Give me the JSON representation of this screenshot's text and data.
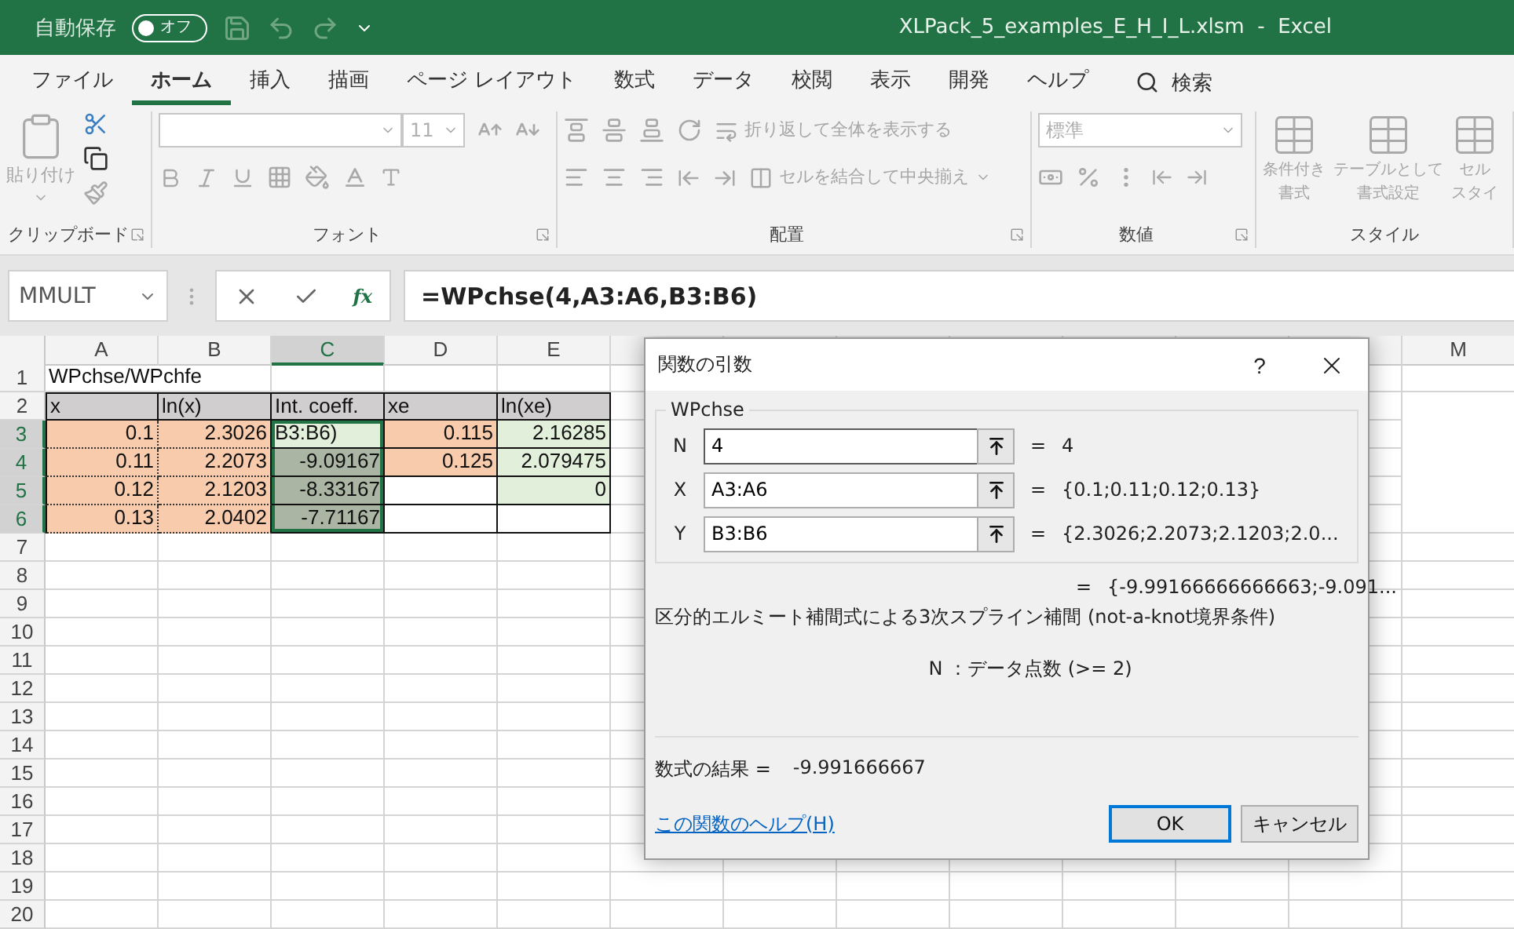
{
  "title_bar": {
    "autosave_label": "自動保存",
    "autosave": {
      "on": false,
      "label": "オフ"
    },
    "title": "XLPack_5_examples_E_H_I_L.xlsm  -  Excel"
  },
  "menu_tabs": [
    {
      "label": "ファイル",
      "selected": false
    },
    {
      "label": "ホーム",
      "selected": true
    },
    {
      "label": "挿入",
      "selected": false
    },
    {
      "label": "描画",
      "selected": false
    },
    {
      "label": "ページ レイアウト",
      "selected": false
    },
    {
      "label": "数式",
      "selected": false
    },
    {
      "label": "データ",
      "selected": false
    },
    {
      "label": "校閲",
      "selected": false
    },
    {
      "label": "表示",
      "selected": false
    },
    {
      "label": "開発",
      "selected": false
    },
    {
      "label": "ヘルプ",
      "selected": false
    }
  ],
  "search_label": "検索",
  "ribbon": {
    "disabled": true,
    "groups": [
      {
        "kind": "clipboard",
        "label": "クリップボード",
        "launcher": true,
        "paste": "貼り付け"
      },
      {
        "kind": "font",
        "label": "フォント",
        "launcher": true,
        "font_size": "11"
      },
      {
        "kind": "alignment",
        "label": "配置",
        "launcher": true,
        "wrap": "折り返して全体を表示する",
        "merge": "セルを結合して中央揃え"
      },
      {
        "kind": "number",
        "label": "数値",
        "launcher": true,
        "format": "標準"
      },
      {
        "kind": "styles",
        "label": "スタイル",
        "launcher": false,
        "buttons": [
          {
            "lines": [
              "条件付き",
              "書式"
            ]
          },
          {
            "lines": [
              "テーブルとして",
              "書式設定"
            ]
          },
          {
            "lines": [
              "セル",
              "スタイ"
            ]
          }
        ]
      }
    ]
  },
  "formula_bar": {
    "name_box": "MMULT",
    "function_button": "fx",
    "formula": "=WPchse(4,A3:A6,B3:B6)"
  },
  "sheet": {
    "columns": [
      {
        "label": "A",
        "selected": false
      },
      {
        "label": "B",
        "selected": false
      },
      {
        "label": "C",
        "selected": true
      },
      {
        "label": "D",
        "selected": false
      },
      {
        "label": "E",
        "selected": false
      },
      {
        "label": "M",
        "selected": false
      }
    ],
    "rows": [
      {
        "header": "1",
        "selected": false,
        "cells": [
          {
            "text": "WPchse/WPchfe",
            "kind": "text"
          }
        ]
      },
      {
        "header": "2",
        "selected": false,
        "cells": [
          {
            "text": "x",
            "kind": "text",
            "bordered": true,
            "color": "#d0cece"
          },
          {
            "text": "ln(x)",
            "kind": "text",
            "bordered": true,
            "color": "#d0cece"
          },
          {
            "text": "Int. coeff.",
            "kind": "text",
            "bordered": true,
            "color": "#d0cece"
          },
          {
            "text": "xe",
            "kind": "text",
            "bordered": true,
            "color": "#d0cece"
          },
          {
            "text": "ln(xe)",
            "kind": "text",
            "bordered": true,
            "color": "#d0cece"
          }
        ]
      },
      {
        "header": "3",
        "selected": true,
        "cells": [
          {
            "text": "0.1",
            "kind": "number",
            "bordered": true,
            "dotted": true,
            "color": "#f8cbad"
          },
          {
            "text": "2.3026",
            "kind": "number",
            "bordered": true,
            "dotted": true,
            "color": "#f8cbad"
          },
          {
            "text": "B3:B6)",
            "kind": "text",
            "bordered": true,
            "color": "#e2efda",
            "selected": true
          },
          {
            "text": "0.115",
            "kind": "number",
            "bordered": true,
            "color": "#f8cbad"
          },
          {
            "text": "2.16285",
            "kind": "number",
            "bordered": true,
            "color": "#e2efda"
          }
        ]
      },
      {
        "header": "4",
        "selected": true,
        "cells": [
          {
            "text": "0.11",
            "kind": "number",
            "bordered": true,
            "dotted": true,
            "color": "#f8cbad"
          },
          {
            "text": "2.2073",
            "kind": "number",
            "bordered": true,
            "dotted": true,
            "color": "#f8cbad"
          },
          {
            "text": "-9.09167",
            "kind": "number",
            "bordered": true,
            "color": "#aab5a4",
            "selected": true
          },
          {
            "text": "0.125",
            "kind": "number",
            "bordered": true,
            "color": "#f8cbad"
          },
          {
            "text": "2.079475",
            "kind": "number",
            "bordered": true,
            "color": "#e2efda"
          }
        ]
      },
      {
        "header": "5",
        "selected": true,
        "cells": [
          {
            "text": "0.12",
            "kind": "number",
            "bordered": true,
            "dotted": true,
            "color": "#f8cbad"
          },
          {
            "text": "2.1203",
            "kind": "number",
            "bordered": true,
            "dotted": true,
            "color": "#f8cbad"
          },
          {
            "text": "-8.33167",
            "kind": "number",
            "bordered": true,
            "color": "#aab5a4",
            "selected": true
          },
          {
            "bordered": true
          },
          {
            "text": "0",
            "kind": "number",
            "bordered": true,
            "color": "#e2efda"
          }
        ]
      },
      {
        "header": "6",
        "selected": true,
        "cells": [
          {
            "text": "0.13",
            "kind": "number",
            "bordered": true,
            "dotted": true,
            "color": "#f8cbad"
          },
          {
            "text": "2.0402",
            "kind": "number",
            "bordered": true,
            "dotted": true,
            "color": "#f8cbad"
          },
          {
            "text": "-7.71167",
            "kind": "number",
            "bordered": true,
            "color": "#aab5a4",
            "selected": true
          },
          {
            "bordered": true
          },
          {
            "bordered": true
          }
        ]
      },
      {
        "header": "7",
        "selected": false
      },
      {
        "header": "8",
        "selected": false
      },
      {
        "header": "9",
        "selected": false
      },
      {
        "header": "10",
        "selected": false
      },
      {
        "header": "11",
        "selected": false
      },
      {
        "header": "12",
        "selected": false
      },
      {
        "header": "13",
        "selected": false
      },
      {
        "header": "14",
        "selected": false
      },
      {
        "header": "15",
        "selected": false
      },
      {
        "header": "16",
        "selected": false
      },
      {
        "header": "17",
        "selected": false
      },
      {
        "header": "18",
        "selected": false
      },
      {
        "header": "19",
        "selected": false
      },
      {
        "header": "20",
        "selected": false
      }
    ]
  },
  "dialog": {
    "title": "関数の引数",
    "help_button": "?",
    "function_name": "WPchse",
    "arguments": [
      {
        "name": "N",
        "value": "4",
        "equals": "=",
        "result": "4",
        "focused": true
      },
      {
        "name": "X",
        "value": "A3:A6",
        "equals": "=",
        "result": "{0.1;0.11;0.12;0.13}",
        "focused": false
      },
      {
        "name": "Y",
        "value": "B3:B6",
        "equals": "=",
        "result": "{2.3026;2.2073;2.1203;2.0...",
        "focused": false
      }
    ],
    "result_equals": "=",
    "result_value": "{-9.99166666666663;-9.091...",
    "description": "区分的エルミート補間式による3次スプライン補間 (not-a-knot境界条件)",
    "argument_help": "N ：データ点数 (>= 2)",
    "formula_result_label": "数式の結果 =",
    "formula_result": "-9.991666667",
    "help_link": "この関数のヘルプ(H)",
    "buttons": [
      {
        "label": "OK",
        "default": true
      },
      {
        "label": "キャンセル",
        "default": false
      }
    ]
  }
}
